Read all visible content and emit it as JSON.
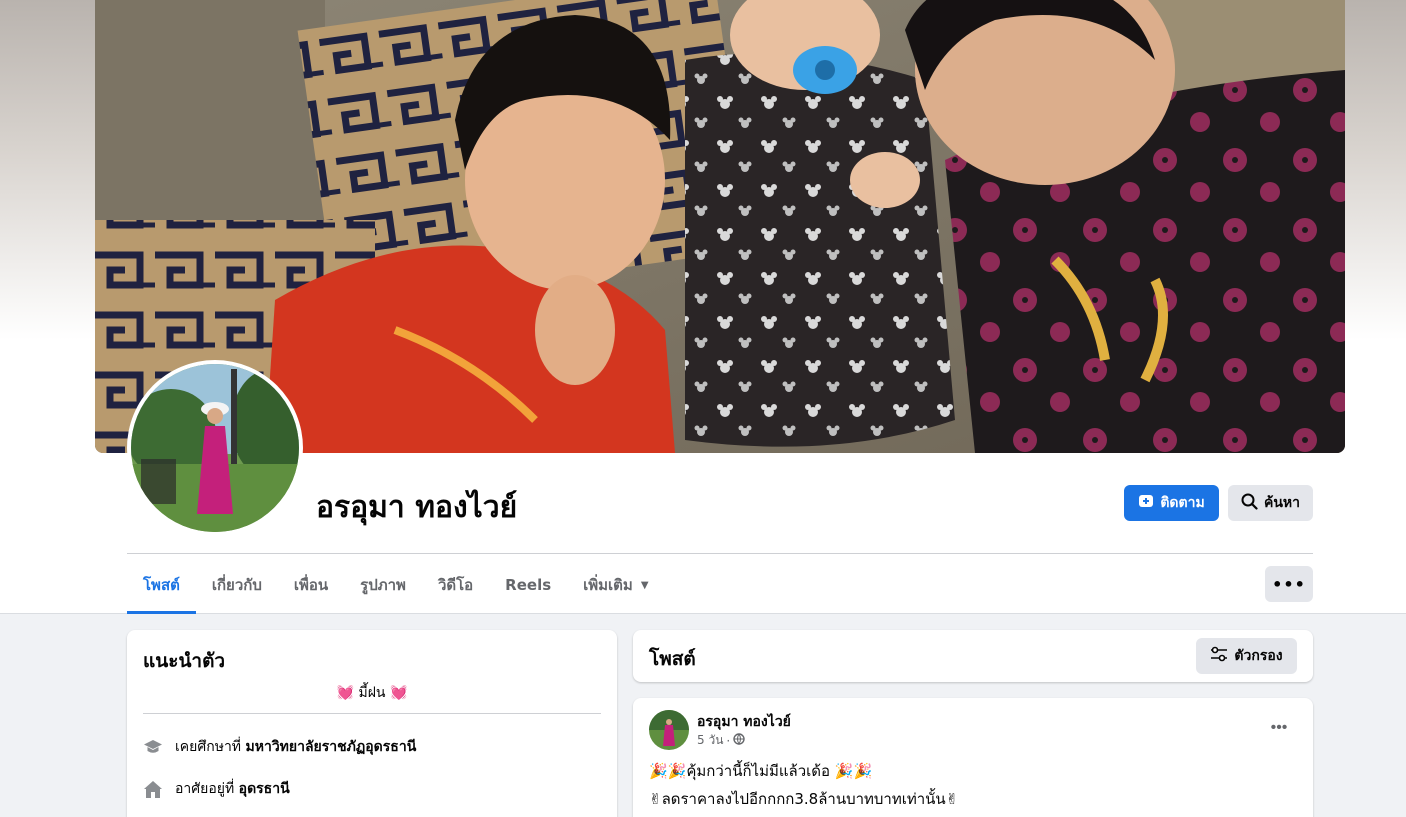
{
  "profile": {
    "name": "อรอุมา ทองไวย์",
    "follow_label": "ติดตาม",
    "search_label": "ค้นหา",
    "more_label": "•••"
  },
  "tabs": [
    {
      "label": "โพสต์",
      "active": true
    },
    {
      "label": "เกี่ยวกับ"
    },
    {
      "label": "เพื่อน"
    },
    {
      "label": "รูปภาพ"
    },
    {
      "label": "วิดีโอ"
    },
    {
      "label": "Reels"
    },
    {
      "label": "เพิ่มเติม"
    }
  ],
  "intro": {
    "title": "แนะนำตัว",
    "bio": "💓 มี้ฝน 💓",
    "education_prefix": "เคยศึกษาที่ ",
    "education_place": "มหาวิทยาลัยราชภัฏอุดรธานี",
    "lives_prefix": "อาศัยอยู่ที่ ",
    "lives_place": "อุดรธานี"
  },
  "posts_header": {
    "title": "โพสต์",
    "filter_label": "ตัวกรอง"
  },
  "post": {
    "author": "อรอุมา ทองไวย์",
    "time": "5 วัน",
    "separator": "·",
    "more_label": "•••",
    "line1": "🎉🎉คุ้มกว่านี้ก็ไม่มีแล้วเด้อ 🎉🎉",
    "line2": "✌ลดราคาลงไปอีกกกก3.8ล้านบาทบาทเท่านั้น✌"
  },
  "colors": {
    "accent": "#1b74e4",
    "page_bg": "#f0f2f5",
    "button_grey": "#e4e6eb",
    "muted_text": "#65676b"
  },
  "icons": {
    "follow": "add-friend-icon",
    "search": "search-icon",
    "filter": "sliders-icon",
    "education": "graduation-cap-icon",
    "home": "home-icon",
    "privacy": "globe-icon"
  }
}
